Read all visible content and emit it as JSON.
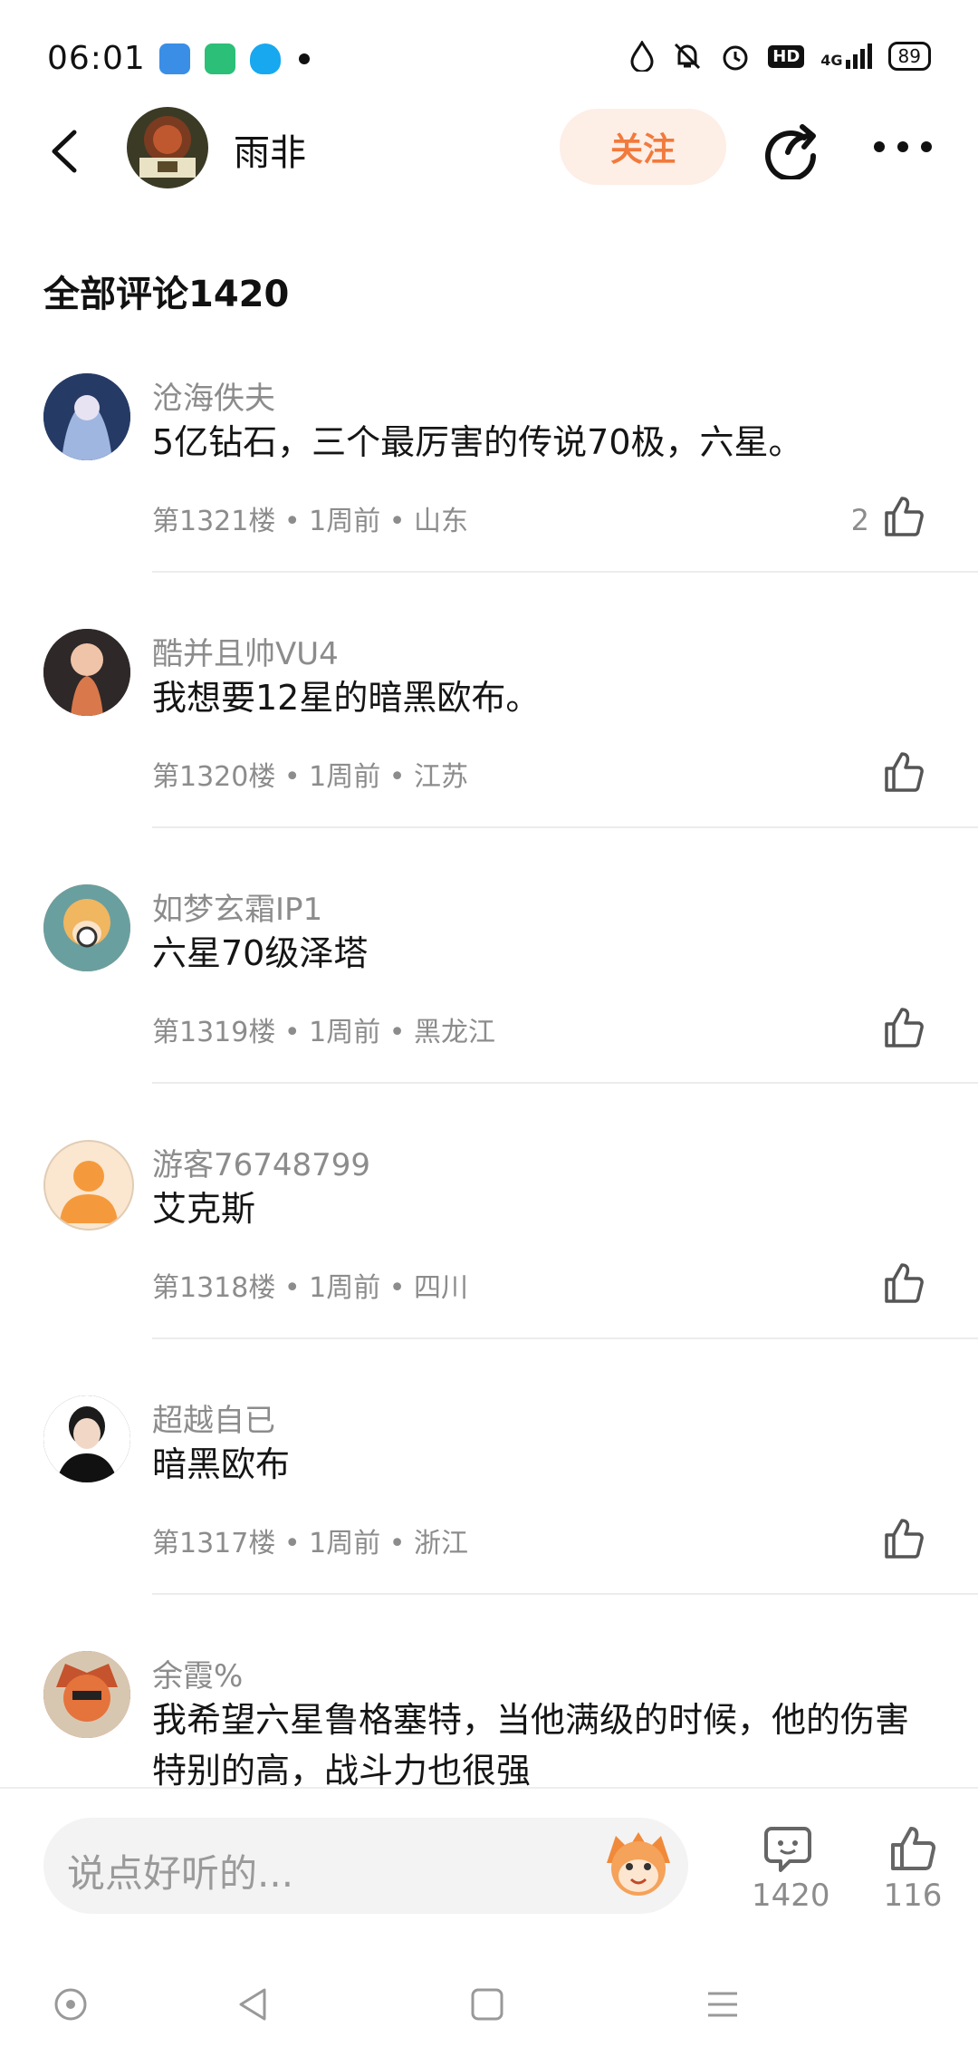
{
  "status_bar": {
    "time": "06:01",
    "battery": "89",
    "network": "4G",
    "hd": "HD"
  },
  "header": {
    "user_name": "雨非",
    "follow_label": "关注",
    "avatar_icon": "avatar-image",
    "back_icon": "back-icon",
    "share_icon": "share-icon",
    "more_icon": "more-icon"
  },
  "comments_title": "全部评论1420",
  "comments": [
    {
      "user": "沧海佚夫",
      "text": "5亿钻石，三个最厉害的传说70极，六星。",
      "meta": "第1321楼 • 1周前 • 山东",
      "likes": "2",
      "avatar_color": "#2d3d63"
    },
    {
      "user": "酷并且帅VU4",
      "text": "我想要12星的暗黑欧布。",
      "meta": "第1320楼 • 1周前 • 江苏",
      "likes": "",
      "avatar_color": "#3a2f2f"
    },
    {
      "user": "如梦玄霜IP1",
      "text": "六星70级泽塔",
      "meta": "第1319楼 • 1周前 • 黑龙江",
      "likes": "",
      "avatar_color": "#e39a55"
    },
    {
      "user": "游客76748799",
      "text": "艾克斯",
      "meta": "第1318楼 • 1周前 • 四川",
      "likes": "",
      "avatar_color": "#fbe6cf"
    },
    {
      "user": "超越自已",
      "text": "暗黑欧布",
      "meta": "第1317楼 • 1周前 • 浙江",
      "likes": "",
      "avatar_color": "#1b1b1b"
    },
    {
      "user": "余霞%",
      "text": "我希望六星鲁格塞特，当他满级的时候，他的伤害特别的高，战斗力也很强",
      "meta": "",
      "likes": "",
      "avatar_color": "#b03e2c"
    }
  ],
  "bottom_bar": {
    "placeholder": "说点好听的...",
    "comment_count": "1420",
    "like_count": "116"
  },
  "colors": {
    "accent": "#f17a3c",
    "follow_bg": "#fdeee6",
    "muted": "#8c8c8c"
  }
}
